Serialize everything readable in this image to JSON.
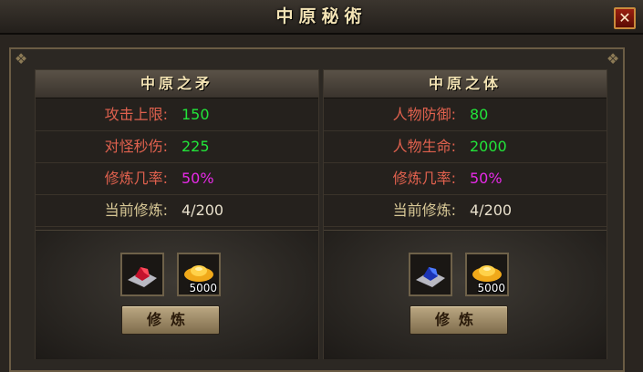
{
  "window": {
    "title": "中原秘術",
    "close_label": "✕"
  },
  "panels": [
    {
      "title": "中原之矛",
      "stats": [
        {
          "label": "攻击上限:",
          "value": "150"
        },
        {
          "label": "对怪秒伤:",
          "value": "225"
        },
        {
          "label": "修炼几率:",
          "value": "50%"
        },
        {
          "label": "当前修炼:",
          "value": "4/200"
        }
      ],
      "gem_icon": "red-gem-icon",
      "gold_icon": "gold-ingot-icon",
      "gold_count": "5000",
      "button_label": "修炼"
    },
    {
      "title": "中原之体",
      "stats": [
        {
          "label": "人物防御:",
          "value": "80"
        },
        {
          "label": "人物生命:",
          "value": "2000"
        },
        {
          "label": "修炼几率:",
          "value": "50%"
        },
        {
          "label": "当前修炼:",
          "value": "4/200"
        }
      ],
      "gem_icon": "blue-gem-icon",
      "gold_icon": "gold-ingot-icon",
      "gold_count": "5000",
      "button_label": "修炼"
    }
  ],
  "colors": {
    "stat_red": "#e0614e",
    "stat_gold": "#d8c896",
    "value_green": "#22e53a",
    "value_magenta": "#e62ae6",
    "value_white": "#e8e0cc"
  }
}
